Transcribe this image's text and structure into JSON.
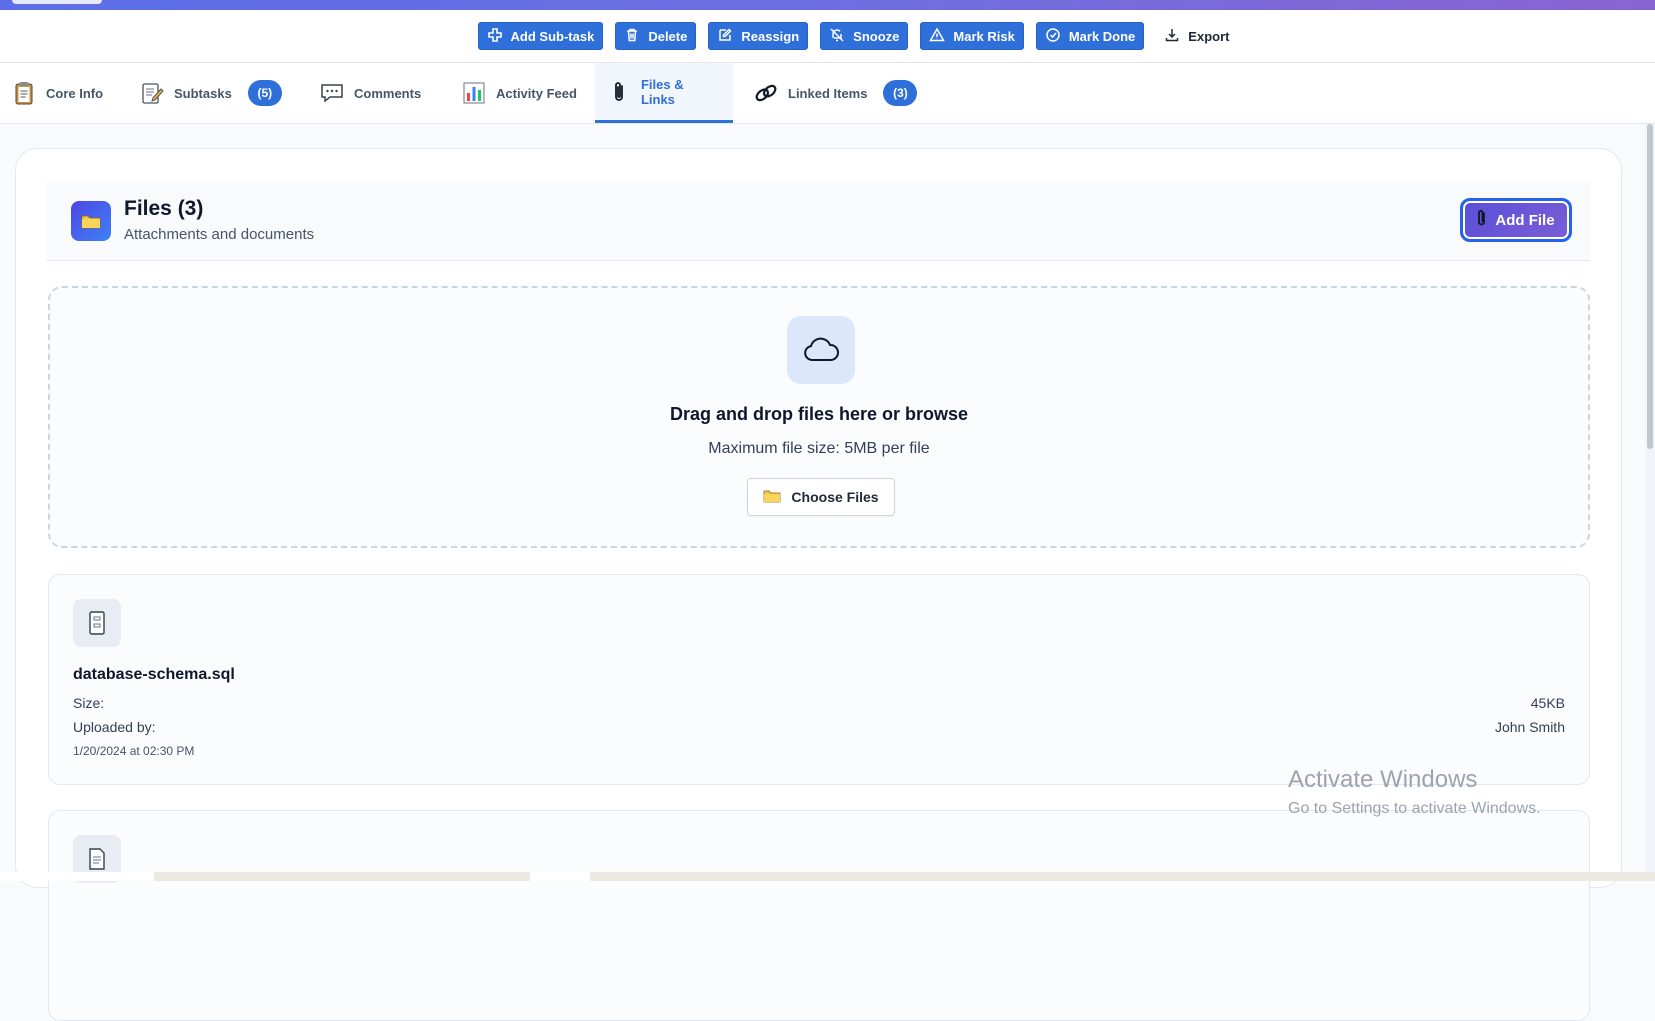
{
  "toolbar": {
    "buttons": [
      {
        "label": "Add Sub-task",
        "icon": "plus-square-icon"
      },
      {
        "label": "Delete",
        "icon": "trash-icon"
      },
      {
        "label": "Reassign",
        "icon": "edit-icon"
      },
      {
        "label": "Snooze",
        "icon": "bell-off-icon"
      },
      {
        "label": "Mark Risk",
        "icon": "warning-icon"
      },
      {
        "label": "Mark Done",
        "icon": "check-circle-icon"
      },
      {
        "label": "Export",
        "icon": "download-icon"
      }
    ]
  },
  "tabs": [
    {
      "label": "Core Info",
      "icon": "clipboard-icon"
    },
    {
      "label": "Subtasks",
      "icon": "memo-icon",
      "badge": "(5)"
    },
    {
      "label": "Comments",
      "icon": "speech-bubble-icon"
    },
    {
      "label": "Activity Feed",
      "icon": "bar-chart-icon"
    },
    {
      "label": "Files & Links",
      "icon": "paperclip-icon",
      "active": true
    },
    {
      "label": "Linked Items",
      "icon": "link-icon",
      "badge": "(3)"
    }
  ],
  "files_section": {
    "title": "Files (3)",
    "subtitle": "Attachments and documents",
    "add_button": "Add File",
    "icon": "folder-icon"
  },
  "dropzone": {
    "title": "Drag and drop files here or browse",
    "subtitle": "Maximum file size: 5MB per file",
    "choose_button": "Choose Files",
    "icon": "cloud-icon"
  },
  "files": [
    {
      "name": "database-schema.sql",
      "size_label": "Size:",
      "size": "45KB",
      "uploaded_label": "Uploaded by:",
      "uploaded_by": "John Smith",
      "date": "1/20/2024 at 02:30 PM",
      "icon": "file-cabinet-icon"
    },
    {
      "icon": "document-icon"
    }
  ],
  "watermark": {
    "line1": "Activate Windows",
    "line2": "Go to Settings to activate Windows."
  },
  "colors": {
    "accent": "#2f6fd9",
    "header_gradient_start": "#5b6ee8",
    "header_gradient_end": "#8a63d2"
  }
}
